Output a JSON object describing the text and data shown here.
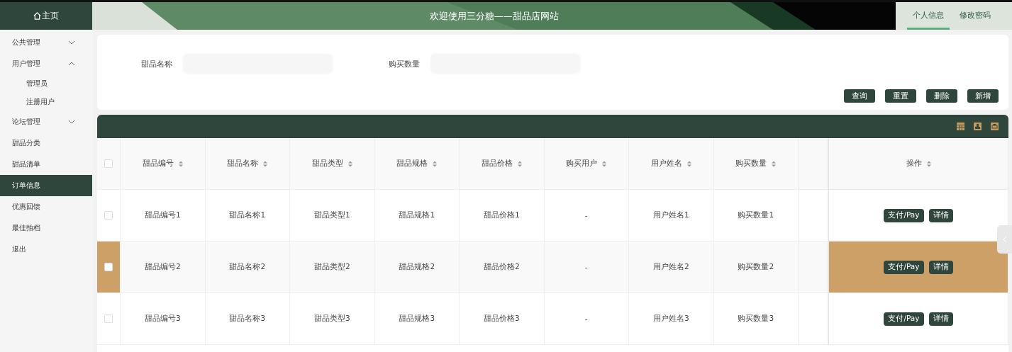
{
  "header": {
    "home": "主页",
    "title": "欢迎使用三分糖——甜品店网站",
    "tabs": [
      {
        "label": "个人信息",
        "selected": true
      },
      {
        "label": "修改密码",
        "selected": false
      }
    ]
  },
  "sidebar": {
    "items": [
      {
        "kind": "group",
        "label": "公共管理",
        "expanded": false,
        "selected": false
      },
      {
        "kind": "group",
        "label": "用户管理",
        "expanded": true,
        "selected": false,
        "children": [
          {
            "label": "管理员",
            "selected": false
          },
          {
            "label": "注册用户",
            "selected": false
          }
        ]
      },
      {
        "kind": "group",
        "label": "论坛管理",
        "expanded": false,
        "selected": false
      },
      {
        "kind": "link",
        "label": "甜品分类",
        "selected": false
      },
      {
        "kind": "link",
        "label": "甜品清单",
        "selected": false
      },
      {
        "kind": "link",
        "label": "订单信息",
        "selected": true
      },
      {
        "kind": "link",
        "label": "优惠回馈",
        "selected": false
      },
      {
        "kind": "link",
        "label": "最佳拍档",
        "selected": false
      },
      {
        "kind": "link",
        "label": "退出",
        "selected": false
      }
    ]
  },
  "search": {
    "fields": [
      {
        "label": "甜品名称"
      },
      {
        "label": "购买数量"
      }
    ],
    "buttons": [
      "查询",
      "重置",
      "删除",
      "新增"
    ]
  },
  "table": {
    "select_all_checked": false,
    "columns": [
      {
        "label": "甜品编号"
      },
      {
        "label": "甜品名称"
      },
      {
        "label": "甜品类型"
      },
      {
        "label": "甜品规格"
      },
      {
        "label": "甜品价格"
      },
      {
        "label": "购买用户"
      },
      {
        "label": "用户姓名"
      },
      {
        "label": "购买数量"
      },
      {
        "kind": "cut"
      },
      {
        "label": "操作"
      }
    ],
    "rows": [
      {
        "checked": false,
        "highlighted": false,
        "cells": [
          "甜品编号1",
          "甜品名称1",
          "甜品类型1",
          "甜品规格1",
          "甜品价格1",
          "-",
          "用户姓名1",
          "购买数量1"
        ],
        "actions": [
          "支付/Pay",
          "详情"
        ]
      },
      {
        "checked": false,
        "highlighted": true,
        "cells": [
          "甜品编号2",
          "甜品名称2",
          "甜品类型2",
          "甜品规格2",
          "甜品价格2",
          "-",
          "用户姓名2",
          "购买数量2"
        ],
        "actions": [
          "支付/Pay",
          "详情"
        ]
      },
      {
        "checked": false,
        "highlighted": false,
        "cells": [
          "甜品编号3",
          "甜品名称3",
          "甜品类型3",
          "甜品规格3",
          "甜品价格3",
          "-",
          "用户姓名3",
          "购买数量3"
        ],
        "actions": [
          "支付/Pay",
          "详情"
        ]
      }
    ]
  }
}
